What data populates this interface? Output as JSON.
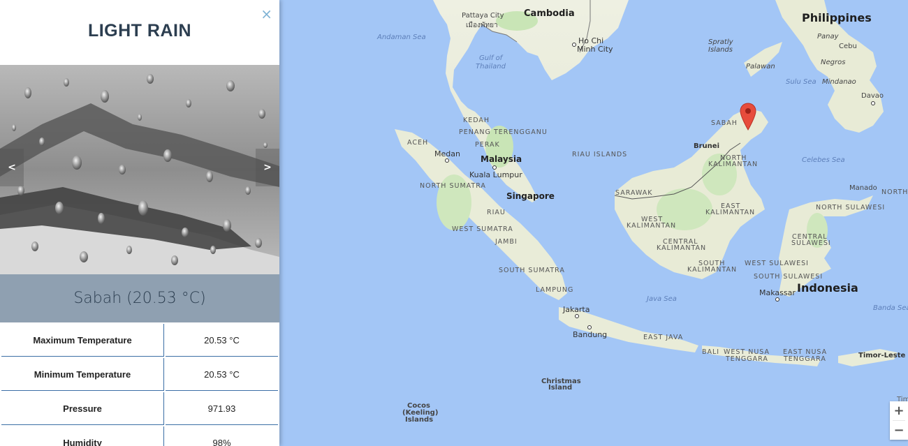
{
  "panel": {
    "close_glyph": "×",
    "title": "LIGHT RAIN",
    "carousel": {
      "prev": "<",
      "next": ">"
    },
    "location": "Sabah (20.53 °C)",
    "stats": [
      {
        "label": "Maximum Temperature",
        "value": "20.53 °C"
      },
      {
        "label": "Minimum Temperature",
        "value": "20.53 °C"
      },
      {
        "label": "Pressure",
        "value": "971.93"
      },
      {
        "label": "Humidity",
        "value": "98%"
      }
    ]
  },
  "map": {
    "zoom_in": "+",
    "zoom_out": "−",
    "marker_color": "#e74c3c",
    "labels": {
      "cambodia": "Cambodia",
      "philippines": "Philippines",
      "pattaya": "Pattaya City",
      "pattaya_thai": "เมืองพัทยา",
      "andaman": "Andaman Sea",
      "ho_chi_minh_1": "Ho Chi",
      "ho_chi_minh_2": "Minh City",
      "gulf_1": "Gulf of",
      "gulf_2": "Thailand",
      "spratly_1": "Spratly",
      "spratly_2": "Islands",
      "panay": "Panay",
      "cebu": "Cebu",
      "negros": "Negros",
      "palawan": "Palawan",
      "sulu": "Sulu Sea",
      "mindanao": "Mindanao",
      "davao": "Davao",
      "kedah": "KEDAH",
      "penang": "PENANG",
      "terengganu": "TERENGGANU",
      "perak": "PERAK",
      "aceh": "ACEH",
      "medan": "Medan",
      "malaysia": "Malaysia",
      "riau_islands": "RIAU ISLANDS",
      "sabah": "SABAH",
      "brunei": "Brunei",
      "north_kalimantan_1": "NORTH",
      "north_kalimantan_2": "KALIMANTAN",
      "celebes": "Celebes Sea",
      "kuala_lumpur": "Kuala Lumpur",
      "north_sumatra": "NORTH SUMATRA",
      "singapore": "Singapore",
      "sarawak": "SARAWAK",
      "manado": "Manado",
      "north": "NORTH",
      "north_sulawesi": "NORTH SULAWESI",
      "riau": "RIAU",
      "west_kalimantan_1": "WEST",
      "west_kalimantan_2": "KALIMANTAN",
      "east_kalimantan_1": "EAST",
      "east_kalimantan_2": "KALIMANTAN",
      "west_sumatra": "WEST SUMATRA",
      "jambi": "JAMBI",
      "central_kalimantan_1": "CENTRAL",
      "central_kalimantan_2": "KALIMANTAN",
      "central_sulawesi_1": "CENTRAL",
      "central_sulawesi_2": "SULAWESI",
      "south_kalimantan_1": "SOUTH",
      "south_kalimantan_2": "KALIMANTAN",
      "west_sulawesi": "WEST SULAWESI",
      "south_sumatra": "SOUTH SUMATRA",
      "south_sulawesi": "SOUTH SULAWESI",
      "indonesia": "Indonesia",
      "lampung": "LAMPUNG",
      "makassar": "Makassar",
      "java_sea": "Java Sea",
      "banda_sea": "Banda Sea",
      "jakarta": "Jakarta",
      "bandung": "Bandung",
      "east_java": "EAST JAVA",
      "bali": "BALI",
      "west_nusa_1": "WEST NUSA",
      "west_nusa_2": "TENGGARA",
      "east_nusa_1": "EAST NUSA",
      "east_nusa_2": "TENGGARA",
      "timor_leste": "Timor-Leste",
      "christmas_1": "Christmas",
      "christmas_2": "Island",
      "cocos_1": "Cocos",
      "cocos_2": "(Keeling)",
      "cocos_3": "Islands",
      "timor_cut": "Tim"
    }
  }
}
